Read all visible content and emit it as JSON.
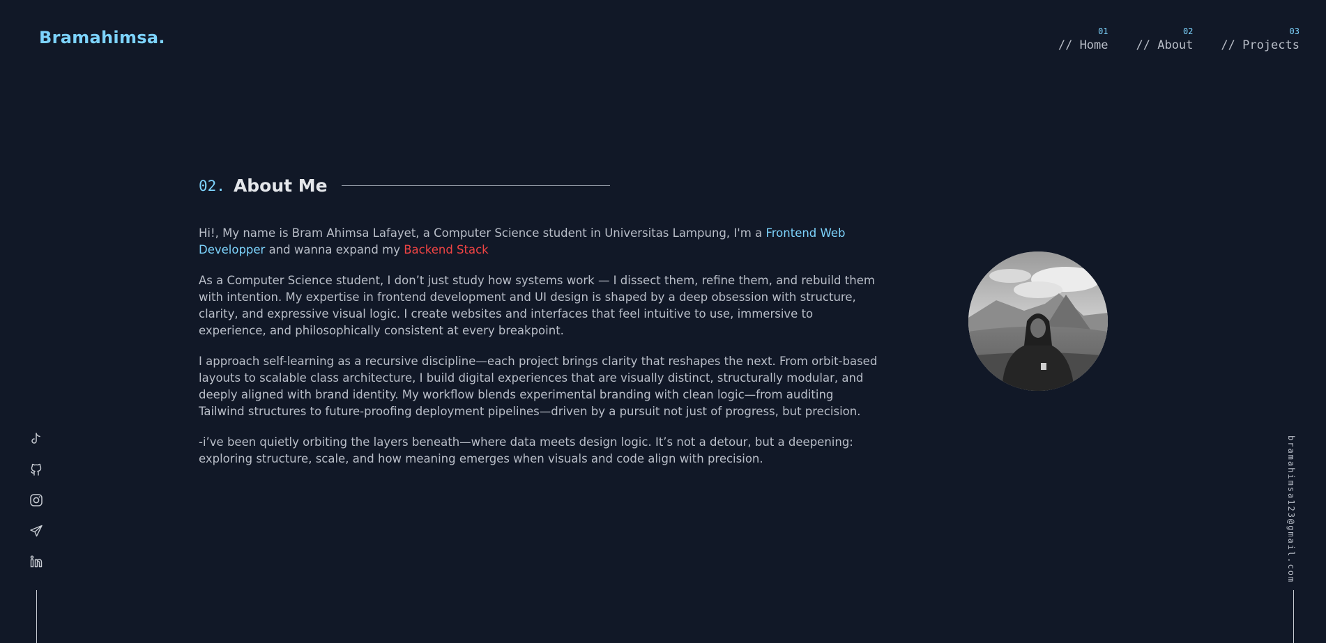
{
  "brand": {
    "logo": "Bramahimsa."
  },
  "nav": [
    {
      "num": "01",
      "label": "// Home"
    },
    {
      "num": "02",
      "label": "// About"
    },
    {
      "num": "03",
      "label": "// Projects"
    }
  ],
  "about": {
    "num": "02.",
    "title": "About Me",
    "p1_a": "Hi!, My name is Bram Ahimsa Lafayet, a Computer Science student in Universitas Lampung, I'm a ",
    "p1_hl1": "Frontend Web Developper",
    "p1_b": " and wanna expand my ",
    "p1_hl2": "Backend Stack",
    "p2": "As a Computer Science student, I don’t just study how systems work — I dissect them, refine them, and rebuild them with intention. My expertise in frontend development and UI design is shaped by a deep obsession with structure, clarity, and expressive visual logic. I create websites and interfaces that feel intuitive to use, immersive to experience, and philosophically consistent at every breakpoint.",
    "p3": "I approach self-learning as a recursive discipline—each project brings clarity that reshapes the next. From orbit-based layouts to scalable class architecture, I build digital experiences that are visually distinct, structurally modular, and deeply aligned with brand identity. My workflow blends experimental branding with clean logic—from auditing Tailwind structures to future-proofing deployment pipelines—driven by a pursuit not just of progress, but precision.",
    "p4": "-i’ve been quietly orbiting the layers beneath—where data meets design logic. It’s not a detour, but a deepening: exploring structure, scale, and how meaning emerges when visuals and code align with precision."
  },
  "socials": [
    "tiktok-icon",
    "github-icon",
    "instagram-icon",
    "telegram-icon",
    "linkedin-icon"
  ],
  "email": "bramahimsa123@gmail.com",
  "colors": {
    "background": "#111827",
    "accent": "#7dd3fc",
    "highlight_red": "#ef4444",
    "text": "#b9bec8"
  }
}
